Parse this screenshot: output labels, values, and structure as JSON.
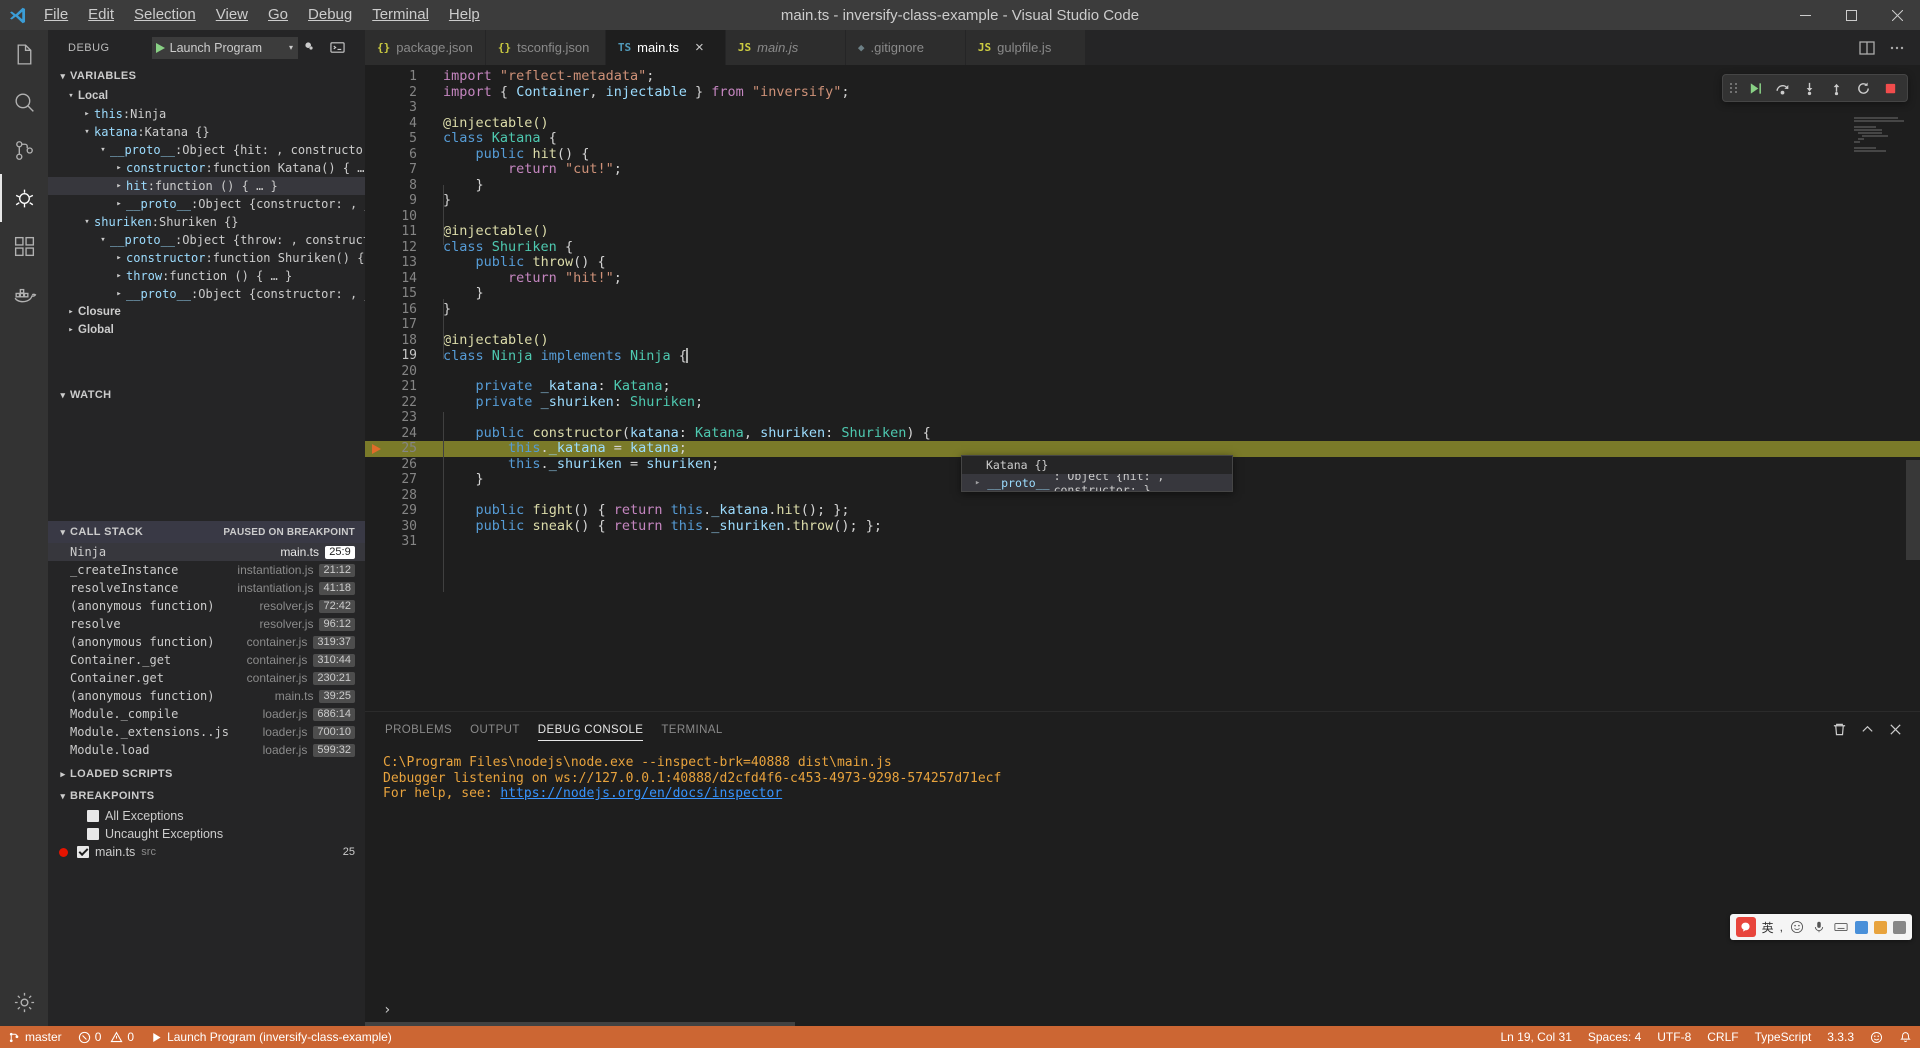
{
  "titlebar": {
    "title": "main.ts - inversify-class-example - Visual Studio Code",
    "menus": [
      "File",
      "Edit",
      "Selection",
      "View",
      "Go",
      "Debug",
      "Terminal",
      "Help"
    ]
  },
  "activitybar": {
    "items": [
      {
        "name": "explorer-icon",
        "label": "Explorer"
      },
      {
        "name": "search-icon",
        "label": "Search"
      },
      {
        "name": "source-control-icon",
        "label": "Source Control"
      },
      {
        "name": "debug-icon",
        "label": "Run and Debug"
      },
      {
        "name": "extensions-icon",
        "label": "Extensions"
      },
      {
        "name": "docker-icon",
        "label": "Docker"
      },
      {
        "name": "settings-gear-icon",
        "label": "Manage"
      }
    ]
  },
  "sidebar": {
    "header": {
      "title": "DEBUG",
      "launch_config": "Launch Program",
      "dropdown_caret": "▾",
      "gear_icon": "gear-icon",
      "console_icon": "open-debug-console-icon"
    },
    "variables": {
      "title": "VARIABLES",
      "rows": [
        {
          "indent": 1,
          "twisty": "expanded",
          "name": "Local",
          "sep": "",
          "value": "",
          "bold": true,
          "selected": false
        },
        {
          "indent": 2,
          "twisty": "collapsed",
          "name": "this",
          "sep": ": ",
          "value": "Ninja",
          "bold": false,
          "selected": false
        },
        {
          "indent": 2,
          "twisty": "expanded",
          "name": "katana",
          "sep": ": ",
          "value": "Katana {}",
          "bold": false,
          "selected": false
        },
        {
          "indent": 3,
          "twisty": "expanded",
          "name": "__proto__",
          "sep": ": ",
          "value": "Object {hit: , constructor: }",
          "bold": false,
          "selected": false
        },
        {
          "indent": 4,
          "twisty": "collapsed",
          "name": "constructor",
          "sep": ": ",
          "value": "function Katana() { … }",
          "bold": false,
          "selected": false
        },
        {
          "indent": 4,
          "twisty": "collapsed",
          "name": "hit",
          "sep": ": ",
          "value": "function () { … }",
          "bold": false,
          "selected": true
        },
        {
          "indent": 4,
          "twisty": "collapsed",
          "name": "__proto__",
          "sep": ": ",
          "value": "Object {constructor: , __defineGette…",
          "bold": false,
          "selected": false
        },
        {
          "indent": 2,
          "twisty": "expanded",
          "name": "shuriken",
          "sep": ": ",
          "value": "Shuriken {}",
          "bold": false,
          "selected": false
        },
        {
          "indent": 3,
          "twisty": "expanded",
          "name": "__proto__",
          "sep": ": ",
          "value": "Object {throw: , constructor: }",
          "bold": false,
          "selected": false
        },
        {
          "indent": 4,
          "twisty": "collapsed",
          "name": "constructor",
          "sep": ": ",
          "value": "function Shuriken() { … }",
          "bold": false,
          "selected": false
        },
        {
          "indent": 4,
          "twisty": "collapsed",
          "name": "throw",
          "sep": ": ",
          "value": "function () { … }",
          "bold": false,
          "selected": false
        },
        {
          "indent": 4,
          "twisty": "collapsed",
          "name": "__proto__",
          "sep": ": ",
          "value": "Object {constructor: , __defineGette…",
          "bold": false,
          "selected": false
        },
        {
          "indent": 1,
          "twisty": "collapsed",
          "name": "Closure",
          "sep": "",
          "value": "",
          "bold": true,
          "selected": false
        },
        {
          "indent": 1,
          "twisty": "collapsed",
          "name": "Global",
          "sep": "",
          "value": "",
          "bold": true,
          "selected": false
        }
      ]
    },
    "watch": {
      "title": "WATCH"
    },
    "callstack": {
      "title": "CALL STACK",
      "status": "PAUSED ON BREAKPOINT",
      "frames": [
        {
          "name": "Ninja",
          "file": "main.ts",
          "pos": "25:9",
          "selected": true
        },
        {
          "name": "_createInstance",
          "file": "instantiation.js",
          "pos": "21:12",
          "selected": false
        },
        {
          "name": "resolveInstance",
          "file": "instantiation.js",
          "pos": "41:18",
          "selected": false
        },
        {
          "name": "(anonymous function)",
          "file": "resolver.js",
          "pos": "72:42",
          "selected": false
        },
        {
          "name": "resolve",
          "file": "resolver.js",
          "pos": "96:12",
          "selected": false
        },
        {
          "name": "(anonymous function)",
          "file": "container.js",
          "pos": "319:37",
          "selected": false
        },
        {
          "name": "Container._get",
          "file": "container.js",
          "pos": "310:44",
          "selected": false
        },
        {
          "name": "Container.get",
          "file": "container.js",
          "pos": "230:21",
          "selected": false
        },
        {
          "name": "(anonymous function)",
          "file": "main.ts",
          "pos": "39:25",
          "selected": false
        },
        {
          "name": "Module._compile",
          "file": "loader.js",
          "pos": "686:14",
          "selected": false
        },
        {
          "name": "Module._extensions..js",
          "file": "loader.js",
          "pos": "700:10",
          "selected": false
        },
        {
          "name": "Module.load",
          "file": "loader.js",
          "pos": "599:32",
          "selected": false
        }
      ]
    },
    "loaded_scripts": {
      "title": "LOADED SCRIPTS"
    },
    "breakpoints": {
      "title": "BREAKPOINTS",
      "items": [
        {
          "label": "All Exceptions",
          "sub": "",
          "checked": false,
          "has_dot": false,
          "line": ""
        },
        {
          "label": "Uncaught Exceptions",
          "sub": "",
          "checked": false,
          "has_dot": false,
          "line": ""
        },
        {
          "label": "main.ts",
          "sub": "src",
          "checked": true,
          "has_dot": true,
          "line": "25"
        }
      ]
    }
  },
  "editor": {
    "tabs": [
      {
        "label": "package.json",
        "icon": "json",
        "icon_text": "{}",
        "active": false,
        "italic": false,
        "closable": false
      },
      {
        "label": "tsconfig.json",
        "icon": "json",
        "icon_text": "{}",
        "active": false,
        "italic": false,
        "closable": false
      },
      {
        "label": "main.ts",
        "icon": "ts",
        "icon_text": "TS",
        "active": true,
        "italic": false,
        "closable": true
      },
      {
        "label": "main.js",
        "icon": "js",
        "icon_text": "JS",
        "active": false,
        "italic": true,
        "closable": false
      },
      {
        "label": ".gitignore",
        "icon": "git",
        "icon_text": "◆",
        "active": false,
        "italic": false,
        "closable": false
      },
      {
        "label": "gulpfile.js",
        "icon": "js",
        "icon_text": "JS",
        "active": false,
        "italic": false,
        "closable": false
      }
    ],
    "tab_actions": [
      "split-editor-icon",
      "more-actions-icon"
    ],
    "close_label": "×",
    "code": [
      {
        "n": 1,
        "html": "<span class='kwp'>import</span> <span class='str'>\"reflect-metadata\"</span><span class='pun'>;</span>"
      },
      {
        "n": 2,
        "html": "<span class='kwp'>import</span> <span class='pun'>{ </span><span class='var'>Container</span><span class='pun'>, </span><span class='var'>injectable</span><span class='pun'> } </span><span class='kwp'>from</span> <span class='str'>\"inversify\"</span><span class='pun'>;</span>"
      },
      {
        "n": 3,
        "html": ""
      },
      {
        "n": 4,
        "html": "<span class='dec'>@injectable()</span>"
      },
      {
        "n": 5,
        "html": "<span class='kw'>class</span> <span class='typ'>Katana</span> <span class='pun'>{</span>"
      },
      {
        "n": 6,
        "html": "    <span class='kw'>public</span> <span class='fn'>hit</span><span class='pun'>() {</span>"
      },
      {
        "n": 7,
        "html": "        <span class='kwp'>return</span> <span class='str'>\"cut!\"</span><span class='pun'>;</span>"
      },
      {
        "n": 8,
        "html": "    <span class='pun'>}</span>"
      },
      {
        "n": 9,
        "html": "<span class='pun'>}</span>"
      },
      {
        "n": 10,
        "html": ""
      },
      {
        "n": 11,
        "html": "<span class='dec'>@injectable()</span>"
      },
      {
        "n": 12,
        "html": "<span class='kw'>class</span> <span class='typ'>Shuriken</span> <span class='pun'>{</span>"
      },
      {
        "n": 13,
        "html": "    <span class='kw'>public</span> <span class='fn'>throw</span><span class='pun'>() {</span>"
      },
      {
        "n": 14,
        "html": "        <span class='kwp'>return</span> <span class='str'>\"hit!\"</span><span class='pun'>;</span>"
      },
      {
        "n": 15,
        "html": "    <span class='pun'>}</span>"
      },
      {
        "n": 16,
        "html": "<span class='pun'>}</span>"
      },
      {
        "n": 17,
        "html": ""
      },
      {
        "n": 18,
        "html": "<span class='dec'>@injectable()</span>"
      },
      {
        "n": 19,
        "html": "<span class='kw'>class</span> <span class='typ'>Ninja</span> <span class='kw'>implements</span> <span class='typ'>Ninja</span> <span class='pun'>{</span>",
        "current": true
      },
      {
        "n": 20,
        "html": ""
      },
      {
        "n": 21,
        "html": "    <span class='kw'>private</span> <span class='var'>_katana</span><span class='pun'>: </span><span class='typ'>Katana</span><span class='pun'>;</span>"
      },
      {
        "n": 22,
        "html": "    <span class='kw'>private</span> <span class='var'>_shuriken</span><span class='pun'>: </span><span class='typ'>Shuriken</span><span class='pun'>;</span>"
      },
      {
        "n": 23,
        "html": ""
      },
      {
        "n": 24,
        "html": "    <span class='kw'>public</span> <span class='fn'>constructor</span><span class='pun'>(</span><span class='var'>katana</span><span class='pun'>: </span><span class='typ'>Katana</span><span class='pun'>, </span><span class='var'>shuriken</span><span class='pun'>: </span><span class='typ'>Shuriken</span><span class='pun'>) {</span>"
      },
      {
        "n": 25,
        "html": "        <span class='kw'>this</span><span class='pun'>.</span><span class='var'>_katana</span> <span class='pun'>=</span> <span class='var'>katana</span><span class='pun'>;</span>",
        "highlight": true,
        "breakpoint": true
      },
      {
        "n": 26,
        "html": "        <span class='kw'>this</span><span class='pun'>.</span><span class='var'>_shuriken</span> <span class='pun'>=</span> <span class='var'>shuriken</span><span class='pun'>;</span>"
      },
      {
        "n": 27,
        "html": "    <span class='pun'>}</span>"
      },
      {
        "n": 28,
        "html": ""
      },
      {
        "n": 29,
        "html": "    <span class='kw'>public</span> <span class='fn'>fight</span><span class='pun'>() { </span><span class='kwp'>return</span> <span class='kw'>this</span><span class='pun'>.</span><span class='var'>_katana</span><span class='pun'>.</span><span class='fn'>hit</span><span class='pun'>(); };</span>"
      },
      {
        "n": 30,
        "html": "    <span class='kw'>public</span> <span class='fn'>sneak</span><span class='pun'>() { </span><span class='kwp'>return</span> <span class='kw'>this</span><span class='pun'>.</span><span class='var'>_shuriken</span><span class='pun'>.</span><span class='fn'>throw</span><span class='pun'>(); };</span>"
      },
      {
        "n": 31,
        "html": ""
      }
    ],
    "hover": {
      "title": "Katana {}",
      "row_key": "__proto__",
      "row_value": ": Object {hit: , constructor: }",
      "twisty": "▸"
    },
    "debug_toolbar": {
      "buttons": [
        {
          "name": "continue-button",
          "label": "Continue"
        },
        {
          "name": "step-over-button",
          "label": "Step Over"
        },
        {
          "name": "step-into-button",
          "label": "Step Into"
        },
        {
          "name": "step-out-button",
          "label": "Step Out"
        },
        {
          "name": "restart-button",
          "label": "Restart"
        },
        {
          "name": "stop-button",
          "label": "Stop"
        }
      ]
    }
  },
  "panel": {
    "tabs": [
      {
        "label": "PROBLEMS",
        "active": false
      },
      {
        "label": "OUTPUT",
        "active": false
      },
      {
        "label": "DEBUG CONSOLE",
        "active": true
      },
      {
        "label": "TERMINAL",
        "active": false
      }
    ],
    "actions": [
      "clear-console-icon",
      "maximize-panel-icon",
      "close-panel-icon"
    ],
    "console_lines": [
      {
        "text": "C:\\Program Files\\nodejs\\node.exe --inspect-brk=40888 dist\\main.js",
        "style": "ok"
      },
      {
        "text": "Debugger listening on ws://127.0.0.1:40888/d2cfd4f6-c453-4973-9298-574257d71ecf",
        "style": "ok"
      },
      {
        "text": "For help, see: https://nodejs.org/en/docs/inspector",
        "style": "ok",
        "link": "https://nodejs.org/en/docs/inspector"
      }
    ],
    "input_prompt": "›"
  },
  "ime": {
    "mode_label": "英",
    "icons": [
      "smiley-icon",
      "microphone-icon",
      "keyboard-icon",
      "screenshot-icon",
      "translate-icon",
      "apps-icon"
    ]
  },
  "statusbar": {
    "branch": "master",
    "branch_icon": "source-control-branch-icon",
    "errors": "0",
    "warnings": "0",
    "error_icon": "error-circle-icon",
    "warning_icon": "warning-triangle-icon",
    "debug_status": "Launch Program (inversify-class-example)",
    "debug_status_icon": "play-icon",
    "cursor": "Ln 19, Col 31",
    "spaces": "Spaces: 4",
    "encoding": "UTF-8",
    "eol": "CRLF",
    "language": "TypeScript",
    "version": "3.3.3",
    "feedback_icon": "smiley-icon",
    "bell_icon": "bell-icon"
  }
}
